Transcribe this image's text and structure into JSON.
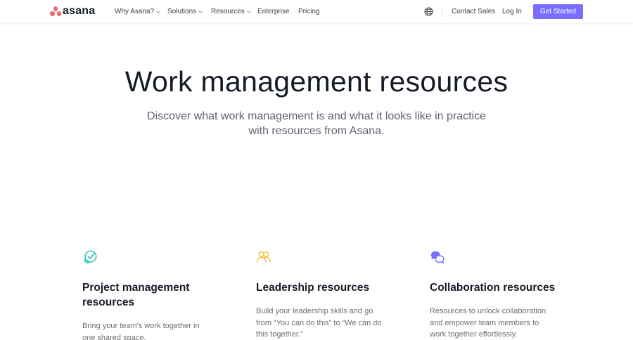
{
  "brand": {
    "name": "asana"
  },
  "nav": {
    "items": [
      {
        "label": "Why Asana?",
        "has_dropdown": true
      },
      {
        "label": "Solutions",
        "has_dropdown": true
      },
      {
        "label": "Resources",
        "has_dropdown": true
      },
      {
        "label": "Enterprise",
        "has_dropdown": false
      },
      {
        "label": "Pricing",
        "has_dropdown": false
      }
    ],
    "language_icon": "globe-icon",
    "contact_sales": "Contact Sales",
    "log_in": "Log In",
    "get_started": "Get Started"
  },
  "hero": {
    "title": "Work management resources",
    "subtitle": "Discover what work management is and what it looks like in practice with resources from Asana."
  },
  "cards": [
    {
      "icon": "checkmark-circle-icon",
      "icon_color": "#29c6b1",
      "title": "Project management resources",
      "description": "Bring your team's work together in one shared space."
    },
    {
      "icon": "people-icon",
      "icon_color": "#f1bd3b",
      "title": "Leadership resources",
      "description": "Build your leadership skills and go from “You can do this” to “We can do this together.”"
    },
    {
      "icon": "chat-bubbles-icon",
      "icon_color": "#796eff",
      "title": "Collaboration resources",
      "description": "Resources to unlock collaboration and empower team members to work together effortlessly."
    }
  ],
  "colors": {
    "brand_coral": "#f06a6a",
    "cta_purple": "#796eff",
    "text_dark": "#151b26"
  }
}
